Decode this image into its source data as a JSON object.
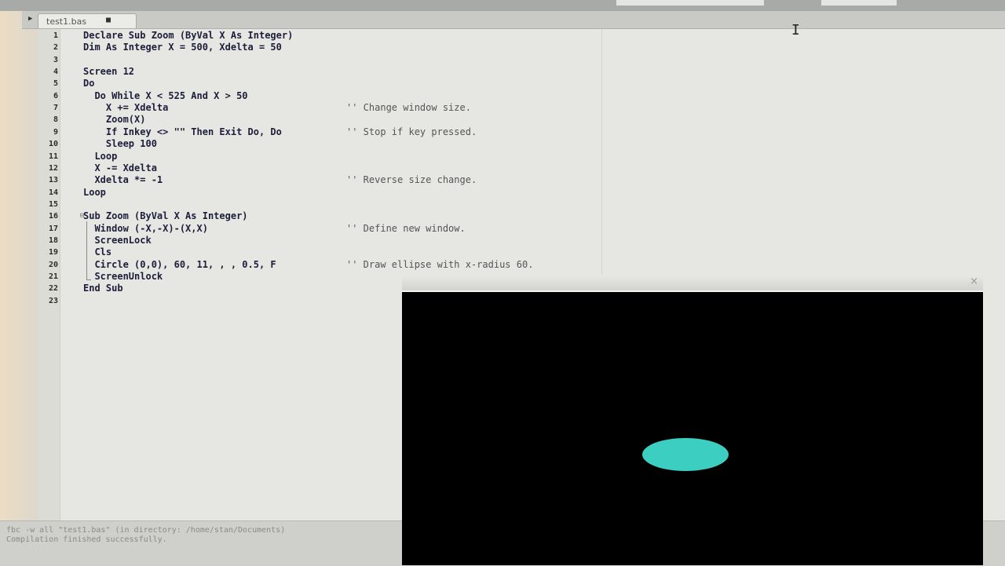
{
  "tab": {
    "label": "test1.bas",
    "modified_marker": "■",
    "scroll_arrow": "▶"
  },
  "code_lines": [
    {
      "n": "1",
      "code": "Declare Sub Zoom (ByVal X As Integer)",
      "comment": ""
    },
    {
      "n": "2",
      "code": "Dim As Integer X = 500, Xdelta = 50",
      "comment": ""
    },
    {
      "n": "3",
      "code": "",
      "comment": ""
    },
    {
      "n": "4",
      "code": "Screen 12",
      "comment": ""
    },
    {
      "n": "5",
      "code": "Do",
      "comment": ""
    },
    {
      "n": "6",
      "code": "  Do While X < 525 And X > 50",
      "comment": ""
    },
    {
      "n": "7",
      "code": "    X += Xdelta",
      "comment": "'' Change window size."
    },
    {
      "n": "8",
      "code": "    Zoom(X)",
      "comment": ""
    },
    {
      "n": "9",
      "code": "    If Inkey <> \"\" Then Exit Do, Do",
      "comment": "'' Stop if key pressed."
    },
    {
      "n": "10",
      "code": "    Sleep 100",
      "comment": ""
    },
    {
      "n": "11",
      "code": "  Loop",
      "comment": ""
    },
    {
      "n": "12",
      "code": "  X -= Xdelta",
      "comment": ""
    },
    {
      "n": "13",
      "code": "  Xdelta *= -1",
      "comment": "'' Reverse size change."
    },
    {
      "n": "14",
      "code": "Loop",
      "comment": ""
    },
    {
      "n": "15",
      "code": "",
      "comment": ""
    },
    {
      "n": "16",
      "code": "Sub Zoom (ByVal X As Integer)",
      "comment": ""
    },
    {
      "n": "17",
      "code": "  Window (-X,-X)-(X,X)",
      "comment": "'' Define new window."
    },
    {
      "n": "18",
      "code": "  ScreenLock",
      "comment": ""
    },
    {
      "n": "19",
      "code": "  Cls",
      "comment": ""
    },
    {
      "n": "20",
      "code": "  Circle (0,0), 60, 11, , , 0.5, F",
      "comment": "'' Draw ellipse with x-radius 60."
    },
    {
      "n": "21",
      "code": "  ScreenUnlock",
      "comment": ""
    },
    {
      "n": "22",
      "code": "End Sub",
      "comment": ""
    },
    {
      "n": "23",
      "code": "",
      "comment": ""
    }
  ],
  "messages": [
    "fbc  -w all \"test1.bas\" (in directory: /home/stan/Documents)",
    "Compilation finished successfully."
  ],
  "graphics_window": {
    "close_glyph": "×",
    "ellipse_color": "#3ccfc1"
  },
  "text_cursor_glyph": "I"
}
